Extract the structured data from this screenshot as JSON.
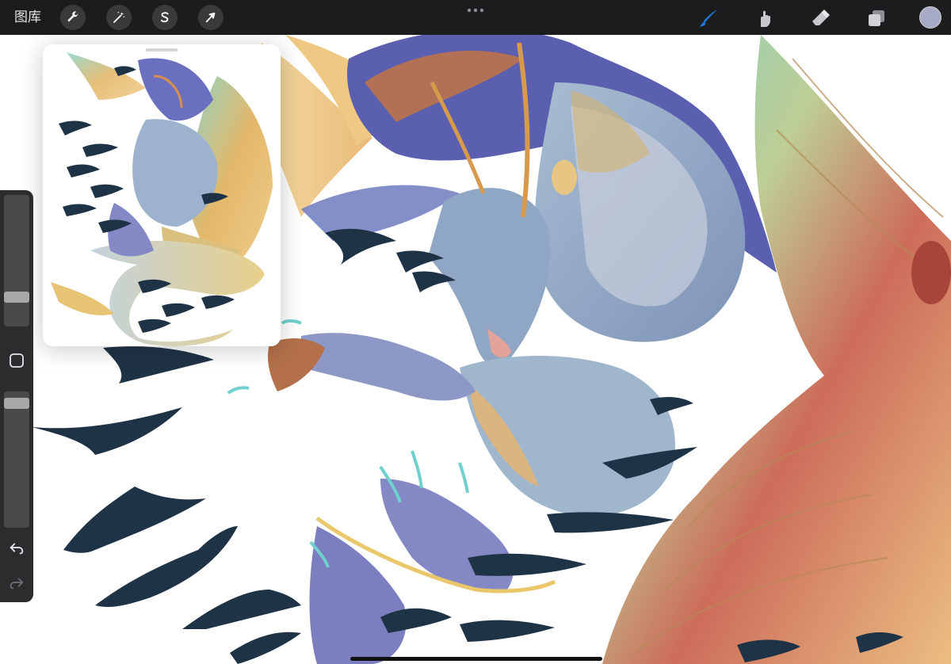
{
  "toolbar": {
    "gallery_label": "图库",
    "left_tools": [
      {
        "name": "actions",
        "icon": "wrench-icon"
      },
      {
        "name": "adjustments",
        "icon": "magic-wand-icon"
      },
      {
        "name": "selection",
        "icon": "selection-s-icon"
      },
      {
        "name": "transform",
        "icon": "arrow-cursor-icon"
      }
    ],
    "more_icon": "more-dots-icon",
    "right_tools": [
      {
        "name": "brush",
        "icon": "brush-icon",
        "active": true
      },
      {
        "name": "smudge",
        "icon": "smudge-finger-icon",
        "active": false
      },
      {
        "name": "eraser",
        "icon": "eraser-icon",
        "active": false
      },
      {
        "name": "layers",
        "icon": "layers-icon",
        "active": false
      }
    ],
    "active_color": "#a6aac4",
    "accent": "#1f7ae0"
  },
  "sidebar": {
    "brush_size_level": 0.2,
    "opacity_level": 0.95,
    "modify_icon": "square-outline-icon",
    "undo_icon": "undo-arrow-icon",
    "redo_icon": "redo-arrow-icon"
  },
  "colors": {
    "toolbar_bg": "#1c1c1e",
    "sidebar_bg": "#2c2c2e",
    "canvas_bg": "#ffffff",
    "bird_silhouette": "#1f3346",
    "dragon_blue": "#8fa6c4",
    "dragon_violet": "#5a5fb0",
    "wing_gold": "#e8b56b",
    "wing_teal": "#6fcbc3",
    "accent_red": "#b55446"
  }
}
